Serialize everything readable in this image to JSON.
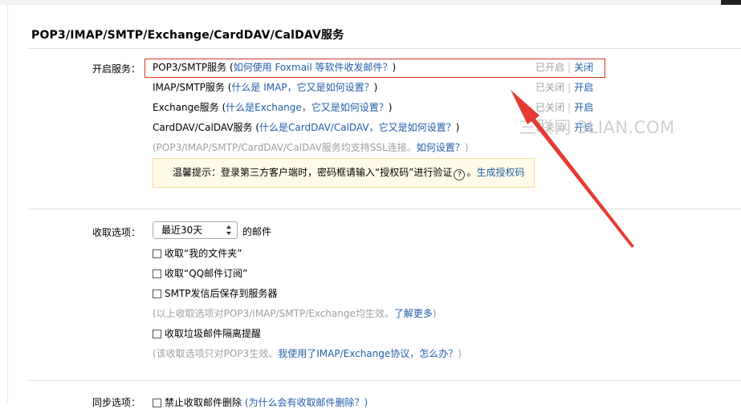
{
  "page_title": "POP3/IMAP/SMTP/Exchange/CardDAV/CalDAV服务",
  "services_label": "开启服务：",
  "services": [
    {
      "name": "POP3/SMTP服务",
      "open_paren": " (",
      "help": "如何使用 Foxmail 等软件收发邮件？",
      "close_paren": ")",
      "status": "已开启",
      "sep": "|",
      "action": "关闭"
    },
    {
      "name": "IMAP/SMTP服务",
      "open_paren": " (",
      "help": "什么是 IMAP，它又是如何设置？",
      "close_paren": ")",
      "status": "已关闭",
      "sep": "|",
      "action": "开启"
    },
    {
      "name": "Exchange服务",
      "open_paren": " (",
      "help": "什么是Exchange，它又是如何设置？",
      "close_paren": ")",
      "status": "已关闭",
      "sep": "|",
      "action": "开启"
    },
    {
      "name": "CardDAV/CalDAV服务",
      "open_paren": " (",
      "help": "什么是CardDAV/CalDAV，它又是如何设置？",
      "close_paren": ")",
      "status": "已关闭",
      "sep": "|",
      "action": "开启"
    }
  ],
  "ssl_note": {
    "text": "(POP3/IMAP/SMTP/CardDAV/CalDAV服务均支持SSL连接。",
    "link": "如何设置？",
    "close": ")"
  },
  "tip": {
    "text": "温馨提示：登录第三方客户端时，密码框请输入“授权码”进行验证",
    "qmark": "?",
    "dot": "。",
    "link": "生成授权码"
  },
  "receive_label": "收取选项：",
  "receive_select": "最近30天",
  "receive_suffix": "的邮件",
  "checkboxes": [
    "收取“我的文件夹”",
    "收取“QQ邮件订阅”",
    "SMTP发信后保存到服务器"
  ],
  "note1": {
    "text": "(以上收取选项对POP3/IMAP/SMTP/Exchange均生效。",
    "link": "了解更多",
    "close": ")"
  },
  "checkbox_spam": "收取垃圾邮件隔离提醒",
  "note2": {
    "text": "(该收取选项只对POP3生效。",
    "link": "我使用了IMAP/Exchange协议，怎么办？",
    "close": ")"
  },
  "bottom_cut": {
    "label": "同步选项：",
    "checkbox": "禁止收取邮件删除",
    "help": "(为什么会有收取邮件删除？)"
  },
  "watermark": "三联网 3LIAN.COM",
  "colors": {
    "link": "#1f5ea8",
    "highlight": "#d9342b",
    "tip_bg": "#fffbe8"
  }
}
